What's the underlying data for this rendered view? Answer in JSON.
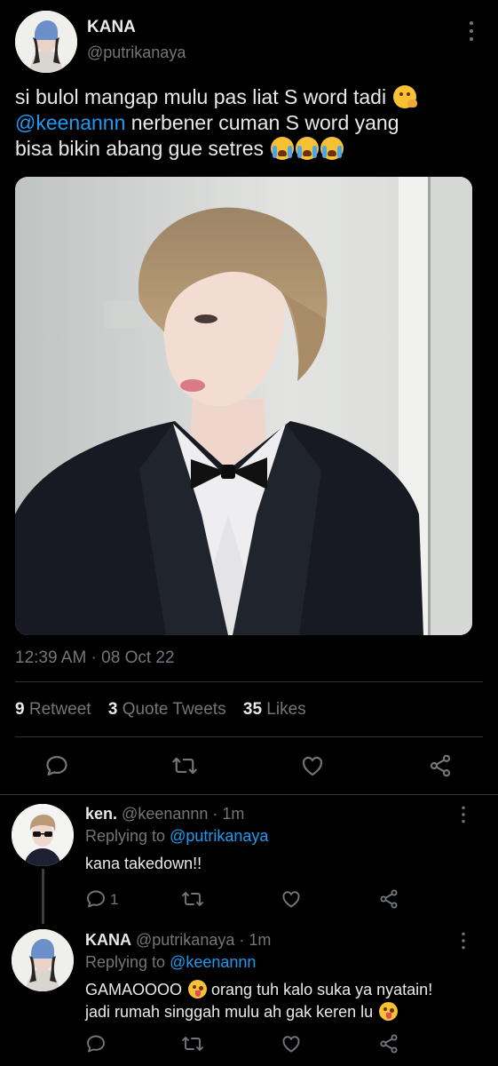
{
  "tweet": {
    "author": {
      "name": "KANA",
      "handle": "@putrikanaya"
    },
    "text_part1": "si bulol mangap mulu pas liat S word tadi",
    "mention": "@keenannn",
    "text_part2": " nerbener cuman S word yang",
    "text_part3": "bisa bikin abang gue setres",
    "timestamp": "12:39 AM · 08 Oct 22",
    "stats": {
      "retweets_count": "9",
      "retweets_label": "Retweet",
      "quotes_count": "3",
      "quotes_label": "Quote Tweets",
      "likes_count": "35",
      "likes_label": "Likes"
    }
  },
  "replies": [
    {
      "name": "ken.",
      "handle": "@keenannn",
      "time": "· 1m",
      "replying_label": "Replying to",
      "replying_to": "@putrikanaya",
      "text": "kana takedown!!",
      "reply_count": "1"
    },
    {
      "name": "KANA",
      "handle": "@putrikanaya",
      "time": "· 1m",
      "replying_label": "Replying to",
      "replying_to": "@keenannn",
      "text_line1": "GAMAOOOO",
      "text_line1b": " orang tuh kalo suka ya nyatain!",
      "text_line2": "jadi rumah singgah mulu ah gak keren lu"
    }
  ],
  "icons": {
    "reply": "speech-bubble-icon",
    "retweet": "retweet-icon",
    "like": "heart-icon",
    "share": "share-icon",
    "more": "three-dots-vertical-icon"
  },
  "colors": {
    "background": "#000000",
    "link": "#1d9bf0",
    "muted": "#71767b",
    "divider": "#2f3336"
  }
}
